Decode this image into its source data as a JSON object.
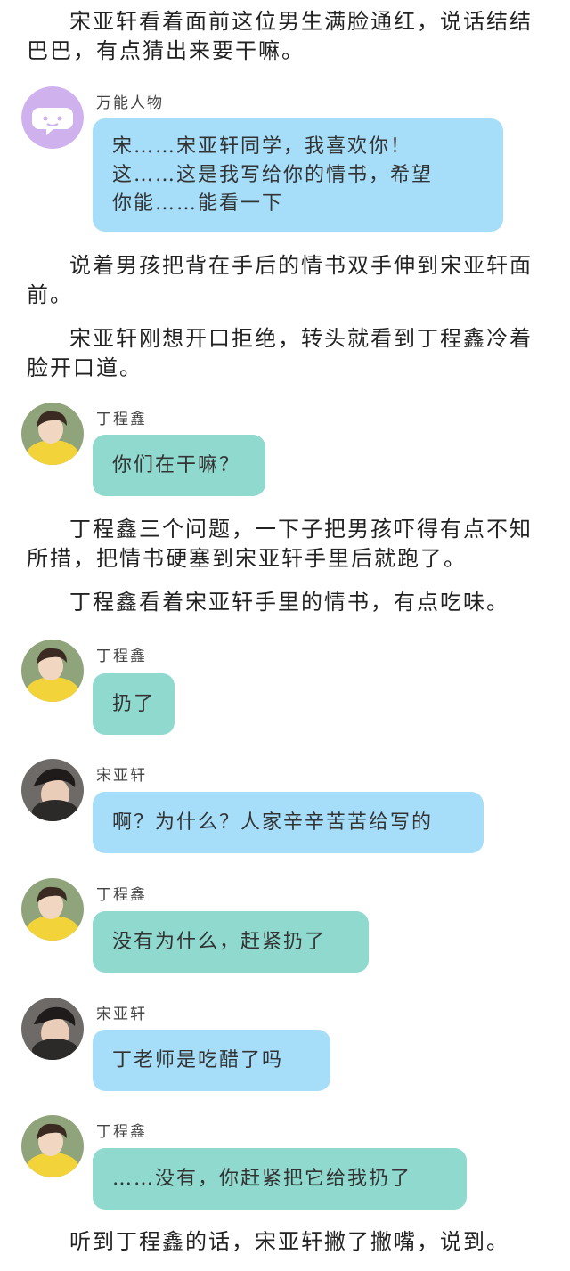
{
  "paragraphs": [
    "宋亚轩看着面前这位男生满脸通红，说话结结巴巴，有点猜出来要干嘛。",
    "说着男孩把背在手后的情书双手伸到宋亚轩面前。",
    "宋亚轩刚想开口拒绝，转头就看到丁程鑫冷着脸开口道。",
    "丁程鑫三个问题，一下子把男孩吓得有点不知所措，把情书硬塞到宋亚轩手里后就跑了。",
    "丁程鑫看着宋亚轩手里的情书，有点吃味。",
    "听到丁程鑫的话，宋亚轩撇了撇嘴，说到。"
  ],
  "messages": [
    {
      "speaker": "万能人物",
      "text": "宋……宋亚轩同学，我喜欢你！\n这……这是我写给你的情书，希望\n你能……能看一下",
      "avatar": "chat-bubble-icon",
      "color": "#a6defa"
    },
    {
      "speaker": "丁程鑫",
      "text": "你们在干嘛？",
      "avatar": "avatar-photo",
      "color": "#8fd9cf"
    },
    {
      "speaker": "丁程鑫",
      "text": "扔了",
      "avatar": "avatar-photo",
      "color": "#8fd9cf"
    },
    {
      "speaker": "宋亚轩",
      "text": "啊？为什么？人家辛辛苦苦给写的",
      "avatar": "avatar-photo",
      "color": "#a6defa"
    },
    {
      "speaker": "丁程鑫",
      "text": "没有为什么，赶紧扔了",
      "avatar": "avatar-photo",
      "color": "#8fd9cf"
    },
    {
      "speaker": "宋亚轩",
      "text": "丁老师是吃醋了吗",
      "avatar": "avatar-photo",
      "color": "#a6defa"
    },
    {
      "speaker": "丁程鑫",
      "text": "……没有，你赶紧把它给我扔了",
      "avatar": "avatar-photo",
      "color": "#8fd9cf"
    }
  ]
}
